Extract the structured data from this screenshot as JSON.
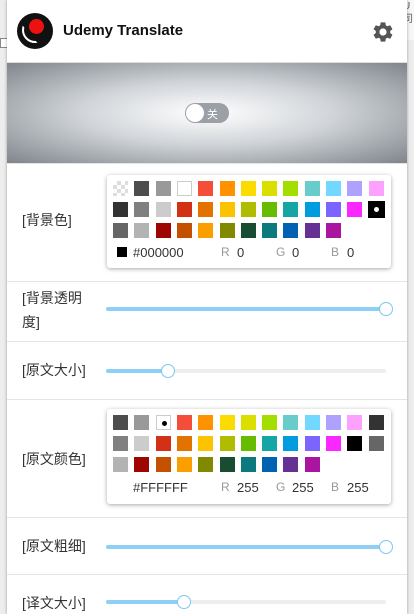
{
  "app": {
    "title": "Udemy Translate"
  },
  "browser": {
    "corner_tip": "U\n司"
  },
  "banner": {
    "toggle_label": "关",
    "toggle_on": false
  },
  "rows": {
    "bg_color": {
      "label": "[背景色]"
    },
    "bg_opacity": {
      "label_line1": "[背景透明",
      "label_line2": "度]",
      "value": 1.0
    },
    "font_size": {
      "label": "[原文大小]",
      "value": 0.22
    },
    "font_color": {
      "label": "[原文颜色]"
    },
    "font_weight": {
      "label": "[原文粗细]",
      "value": 1.0
    },
    "next": {
      "label": "[译文大小]",
      "value": 0.28
    }
  },
  "bg_picker": {
    "hex": "#000000",
    "r_key": "R",
    "r": "0",
    "g_key": "G",
    "g": "0",
    "b_key": "B",
    "b": "0",
    "current_color": "#000000",
    "selected": "#000000",
    "colors": [
      "transparent",
      "#4d4d4d",
      "#999999",
      "#ffffff",
      "#f44e3b",
      "#fe9200",
      "#fcdc00",
      "#dbdf00",
      "#a4dd00",
      "#68ccca",
      "#73d8ff",
      "#aea1ff",
      "#fda1ff",
      "#333333",
      "#808080",
      "#cccccc",
      "#d33115",
      "#e27300",
      "#fcc400",
      "#b0bc00",
      "#68bc00",
      "#16a5a5",
      "#009ce0",
      "#7b64ff",
      "#fa28ff",
      "#000000",
      "#666666",
      "#b3b3b3",
      "#9f0500",
      "#c45100",
      "#fb9e00",
      "#808900",
      "#194d33",
      "#0c797d",
      "#0062b1",
      "#653294",
      "#ab149e"
    ]
  },
  "font_picker": {
    "hex": "#FFFFFF",
    "r_key": "R",
    "r": "255",
    "g_key": "G",
    "g": "255",
    "b_key": "B",
    "b": "255",
    "current_color": "#ffffff",
    "selected": "#ffffff",
    "colors": [
      "#4d4d4d",
      "#999999",
      "#ffffff",
      "#f44e3b",
      "#fe9200",
      "#fcdc00",
      "#dbdf00",
      "#a4dd00",
      "#68ccca",
      "#73d8ff",
      "#aea1ff",
      "#fda1ff",
      "#333333",
      "#808080",
      "#cccccc",
      "#d33115",
      "#e27300",
      "#fcc400",
      "#b0bc00",
      "#68bc00",
      "#16a5a5",
      "#009ce0",
      "#7b64ff",
      "#fa28ff",
      "#000000",
      "#666666",
      "#b3b3b3",
      "#9f0500",
      "#c45100",
      "#fb9e00",
      "#808900",
      "#194d33",
      "#0c797d",
      "#0062b1",
      "#653294",
      "#ab149e"
    ]
  }
}
